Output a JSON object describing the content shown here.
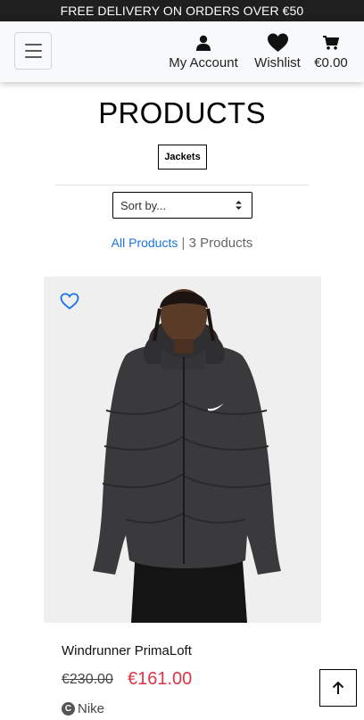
{
  "banner": {
    "text": "FREE DELIVERY ON ORDERS OVER €50"
  },
  "nav": {
    "menu_icon": "hamburger-icon",
    "account": {
      "label": "My Account",
      "icon": "user-icon"
    },
    "wishlist": {
      "label": "Wishlist",
      "icon": "heart-icon"
    },
    "cart": {
      "label": "€0.00",
      "icon": "cart-icon"
    }
  },
  "page": {
    "title": "PRODUCTS",
    "category_badge": "Jackets",
    "sort_placeholder": "Sort by...",
    "all_products_link": "All Products",
    "separator": "|",
    "product_count": "3 Products"
  },
  "products": [
    {
      "name": "Windrunner PrimaLoft",
      "original_price": "€230.00",
      "sale_price": "€161.00",
      "brand": "Nike",
      "brand_icon": "brand-badge-icon",
      "wishlist_icon": "heart-outline-icon"
    }
  ],
  "colors": {
    "banner_bg": "#1f1f1f",
    "link_blue": "#1a73e8",
    "sale_red": "#dc3545"
  }
}
